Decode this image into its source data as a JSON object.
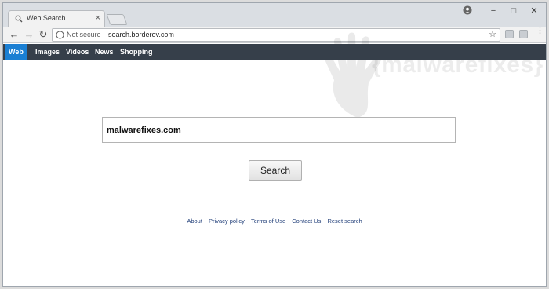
{
  "tab": {
    "title": "Web Search",
    "close_glyph": "×"
  },
  "window_controls": {
    "minimize": "−",
    "maximize": "□",
    "close": "✕"
  },
  "toolbar": {
    "back_glyph": "←",
    "forward_glyph": "→",
    "reload_glyph": "↻",
    "security_label": "Not secure",
    "url": "search.borderov.com",
    "star_glyph": "☆",
    "menu_glyph": "⋮"
  },
  "search_nav": {
    "items": [
      "Web",
      "Images",
      "Videos",
      "News",
      "Shopping"
    ],
    "active": "Web",
    "bar_color": "#363f4a",
    "active_color": "#1a7fd3"
  },
  "watermark": {
    "text": "{malwarefixes}"
  },
  "search": {
    "query": "malwarefixes.com",
    "button_label": "Search"
  },
  "footer": {
    "links": [
      "About",
      "Privacy policy",
      "Terms of Use",
      "Contact Us",
      "Reset search"
    ]
  },
  "icons": [
    "search-icon",
    "info-icon",
    "star-icon",
    "account-icon",
    "extension-icon",
    "menu-icon",
    "hand-watermark"
  ]
}
